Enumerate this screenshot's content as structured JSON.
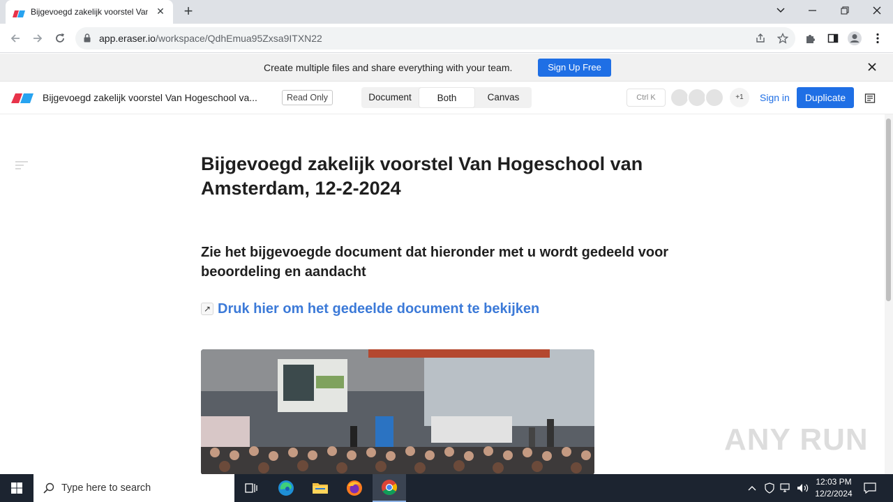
{
  "browser": {
    "tab_title": "Bijgevoegd zakelijk voorstel Van",
    "new_tab": "+",
    "url_domain": "app.eraser.io",
    "url_path": "/workspace/QdhEmua95Zxsa9ITXN22"
  },
  "banner": {
    "text": "Create multiple files and share everything with your team.",
    "signup_label": "Sign Up Free"
  },
  "header": {
    "doc_title": "Bijgevoegd zakelijk voorstel Van Hogeschool va...",
    "read_only": "Read Only",
    "modes": [
      "Document",
      "Both",
      "Canvas"
    ],
    "active_mode": "Both",
    "shortcut": "Ctrl K",
    "avatar_extra": "+1",
    "signin_label": "Sign in",
    "duplicate_label": "Duplicate"
  },
  "document": {
    "title": "Bijgevoegd zakelijk voorstel Van Hogeschool van Amsterdam, 12-2-2024",
    "subtitle": "Zie het bijgevoegde document dat hieronder met u wordt gedeeld voor beoordeling en aandacht",
    "link_arrow": "↗",
    "link_text": "Druk hier om het gedeelde document te bekijken"
  },
  "watermark": "ANY RUN",
  "taskbar": {
    "search_placeholder": "Type here to search",
    "time": "12:03 PM",
    "date": "12/2/2024"
  },
  "colors": {
    "accent": "#1f6fe5",
    "link": "#3c7ad8",
    "taskbar": "#1c2430"
  }
}
